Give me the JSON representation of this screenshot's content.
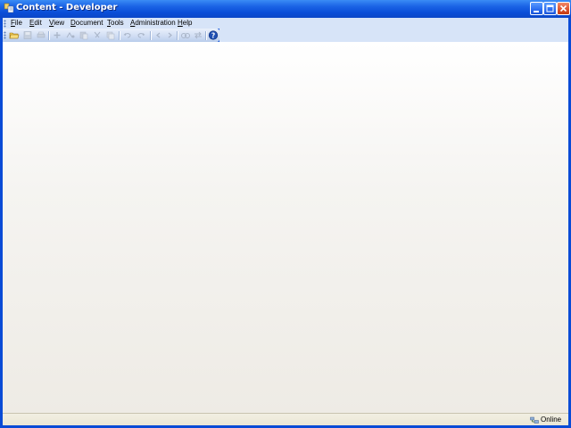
{
  "window": {
    "title": "Content - Developer"
  },
  "menubar": {
    "items": [
      {
        "label": "File"
      },
      {
        "label": "Edit"
      },
      {
        "label": "View"
      },
      {
        "label": "Document"
      },
      {
        "label": "Tools"
      },
      {
        "label": "Administration"
      },
      {
        "label": "Help"
      }
    ]
  },
  "toolbar": {
    "buttons": [
      {
        "icon": "open-folder-icon",
        "enabled": true
      },
      {
        "icon": "save-icon",
        "enabled": false
      },
      {
        "icon": "print-icon",
        "enabled": false
      },
      {
        "icon": "new-icon",
        "enabled": false
      },
      {
        "icon": "bold-icon",
        "enabled": false
      },
      {
        "icon": "paste-icon",
        "enabled": false
      },
      {
        "icon": "cut-icon",
        "enabled": false
      },
      {
        "icon": "copy-icon",
        "enabled": false
      },
      {
        "icon": "undo-icon",
        "enabled": false
      },
      {
        "icon": "redo-icon",
        "enabled": false
      },
      {
        "icon": "back-icon",
        "enabled": false
      },
      {
        "icon": "forward-icon",
        "enabled": false
      },
      {
        "icon": "find-icon",
        "enabled": false
      },
      {
        "icon": "replace-icon",
        "enabled": false
      },
      {
        "icon": "help-icon",
        "enabled": true
      }
    ]
  },
  "statusbar": {
    "status": "Online"
  },
  "colors": {
    "titlebar": "#0a4ed8",
    "menubar": "#d7e4f8",
    "statusbar": "#ebe7d6"
  }
}
